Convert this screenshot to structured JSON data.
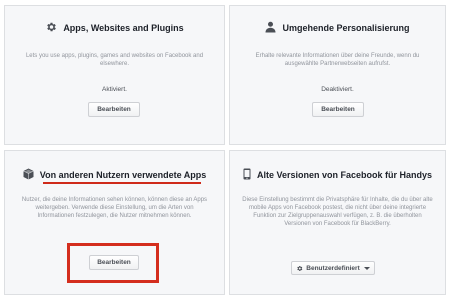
{
  "panels": [
    {
      "title": "Apps, Websites and Plugins",
      "icon": "gear-icon",
      "description": "Lets you use apps, plugins, games and websites on Facebook and elsewhere.",
      "status": "Aktiviert.",
      "button": "Bearbeiten"
    },
    {
      "title": "Umgehende Personalisierung",
      "icon": "person-icon",
      "description": "Erhalte relevante Informationen über deine Freunde, wenn du ausgewählte Partnerwebseiten aufrufst.",
      "status": "Deaktiviert.",
      "button": "Bearbeiten"
    },
    {
      "title": "Von anderen Nutzern verwendete Apps",
      "icon": "cube-icon",
      "description": "Nutzer, die deine Informationen sehen können, können diese an Apps weitergeben. Verwende diese Einstellung, um die Arten von Informationen festzulegen, die Nutzer mitnehmen können.",
      "button": "Bearbeiten"
    },
    {
      "title": "Alte Versionen von Facebook für Handys",
      "icon": "mobile-phone-icon",
      "description": "Diese Einstellung bestimmt die Privatsphäre für Inhalte, die du über alte mobile Apps von Facebook postest, die nicht über deine integrierte Funktion zur Zielgruppenauswahl verfügen, z. B. die überholten Versionen von Facebook für BlackBerry.",
      "dropdown": "Benutzerdefiniert",
      "dropdown_icon": "gear-icon"
    }
  ],
  "annotations": {
    "color": "#d42e1e"
  }
}
